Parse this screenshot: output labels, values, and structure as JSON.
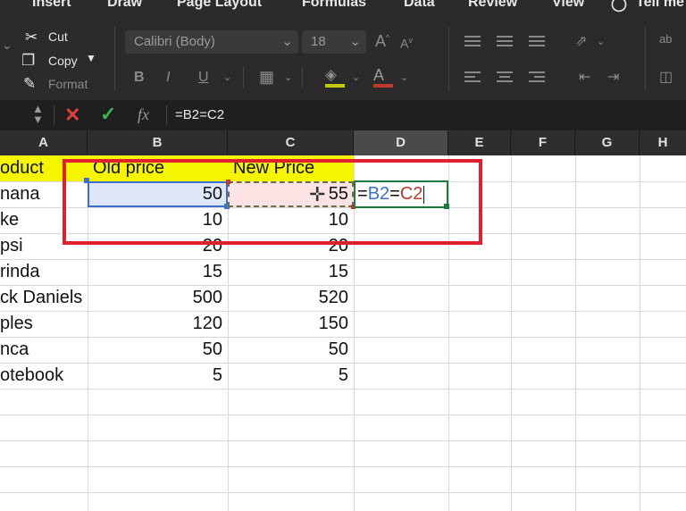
{
  "ribbon": {
    "tabs": [
      "Insert",
      "Draw",
      "Page Layout",
      "Formulas",
      "Data",
      "Review",
      "View",
      "Tell me"
    ],
    "clipboard": {
      "cut": "Cut",
      "copy": "Copy",
      "format": "Format"
    },
    "font_name": "Calibri (Body)",
    "font_size": "18",
    "bold": "B",
    "italic": "I",
    "underline": "U",
    "font_color_glyph": "A"
  },
  "formula_bar": {
    "fx": "fx",
    "formula": "=B2=C2"
  },
  "columns": [
    "A",
    "B",
    "C",
    "D",
    "E",
    "F",
    "G",
    "H"
  ],
  "header_row": {
    "a": "oduct",
    "b": "Old price",
    "c": "New Price"
  },
  "rows": [
    {
      "a": "nana",
      "b": "50",
      "c": "55"
    },
    {
      "a": "ke",
      "b": "10",
      "c": "10"
    },
    {
      "a": "psi",
      "b": "20",
      "c": "20"
    },
    {
      "a": "rinda",
      "b": "15",
      "c": "15"
    },
    {
      "a": "ck Daniels",
      "b": "500",
      "c": "520"
    },
    {
      "a": "ples",
      "b": "120",
      "c": "150"
    },
    {
      "a": "nca",
      "b": "50",
      "c": "50"
    },
    {
      "a": "otebook",
      "b": "5",
      "c": "5"
    }
  ],
  "edit_cell": {
    "eq": "=",
    "ref1": "B2",
    "op": "=",
    "ref2": "C2"
  },
  "colors": {
    "highlight_yellow": "#f5f500",
    "ref_blue": "#3a6fd0",
    "ref_red": "#c0392b",
    "annotation_red": "#e01f2f",
    "active_green": "#1e7a3c"
  }
}
